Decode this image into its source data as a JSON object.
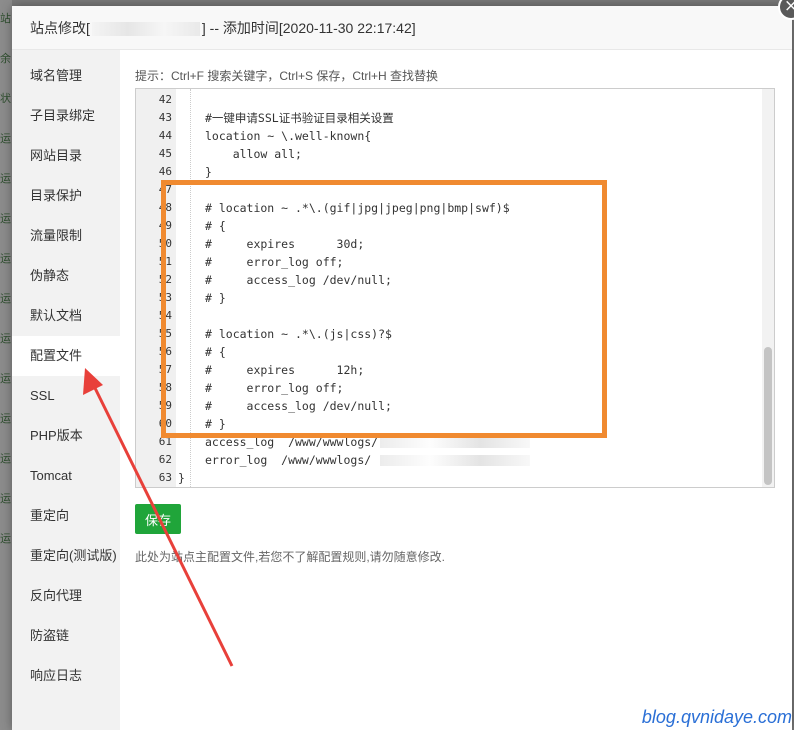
{
  "background": {
    "left_strip": [
      "站",
      "余",
      "状",
      "运",
      "运",
      "运",
      "运",
      "运",
      "运",
      "运",
      "运",
      "运",
      "运",
      "运"
    ]
  },
  "modal": {
    "title_prefix": "站点修改[",
    "title_suffix": "] -- 添加时间[2020-11-30 22:17:42]",
    "close_label": "×"
  },
  "sidebar": {
    "items": [
      {
        "label": "域名管理"
      },
      {
        "label": "子目录绑定"
      },
      {
        "label": "网站目录"
      },
      {
        "label": "目录保护"
      },
      {
        "label": "流量限制"
      },
      {
        "label": "伪静态"
      },
      {
        "label": "默认文档"
      },
      {
        "label": "配置文件"
      },
      {
        "label": "SSL"
      },
      {
        "label": "PHP版本"
      },
      {
        "label": "Tomcat"
      },
      {
        "label": "重定向"
      },
      {
        "label": "重定向(测试版)"
      },
      {
        "label": "反向代理"
      },
      {
        "label": "防盗链"
      },
      {
        "label": "响应日志"
      }
    ],
    "active": "配置文件"
  },
  "content": {
    "tip": "提示：Ctrl+F 搜索关键字，Ctrl+S 保存，Ctrl+H 查找替换",
    "save_label": "保存",
    "note": "此处为站点主配置文件,若您不了解配置规则,请勿随意修改."
  },
  "editor": {
    "lines": [
      {
        "num": "42",
        "code": ""
      },
      {
        "num": "43",
        "code": "#一键申请SSL证书验证目录相关设置",
        "cls": "c-comment"
      },
      {
        "num": "44",
        "code": "location ~ \\.well-known{",
        "cls": "c-kw"
      },
      {
        "num": "45",
        "code": "    allow all;",
        "cls": "c-kw"
      },
      {
        "num": "46",
        "code": "}",
        "cls": ""
      },
      {
        "num": "47",
        "code": ""
      },
      {
        "num": "48",
        "code": "# location ~ .*\\.(gif|jpg|jpeg|png|bmp|swf)$",
        "cls": "c-comment"
      },
      {
        "num": "49",
        "code": "# {",
        "cls": "c-comment"
      },
      {
        "num": "50",
        "code": "#     expires      30d;",
        "cls": "c-comment"
      },
      {
        "num": "51",
        "code": "#     error_log off;",
        "cls": "c-comment"
      },
      {
        "num": "52",
        "code": "#     access_log /dev/null;",
        "cls": "c-comment"
      },
      {
        "num": "53",
        "code": "# }",
        "cls": "c-comment"
      },
      {
        "num": "54",
        "code": ""
      },
      {
        "num": "55",
        "code": "# location ~ .*\\.(js|css)?$",
        "cls": "c-comment"
      },
      {
        "num": "56",
        "code": "# {",
        "cls": "c-comment"
      },
      {
        "num": "57",
        "code": "#     expires      12h;",
        "cls": "c-comment"
      },
      {
        "num": "58",
        "code": "#     error_log off;",
        "cls": "c-comment"
      },
      {
        "num": "59",
        "code": "#     access_log /dev/null;",
        "cls": "c-comment"
      },
      {
        "num": "60",
        "code": "# }",
        "cls": "c-comment"
      },
      {
        "num": "61",
        "code": "access_log  /www/wwwlogs/",
        "cls": "c-kw",
        "redacted": true
      },
      {
        "num": "62",
        "code": "error_log  /www/wwwlogs/",
        "cls": "c-kw",
        "redacted": true
      },
      {
        "num": "63",
        "code": "}",
        "cls": "",
        "close": true
      }
    ]
  },
  "watermark": "blog.qvnidaye.com",
  "colors": {
    "save_green": "#20a53a",
    "highlight_orange": "#f08a30",
    "arrow_red": "#e8403a"
  }
}
